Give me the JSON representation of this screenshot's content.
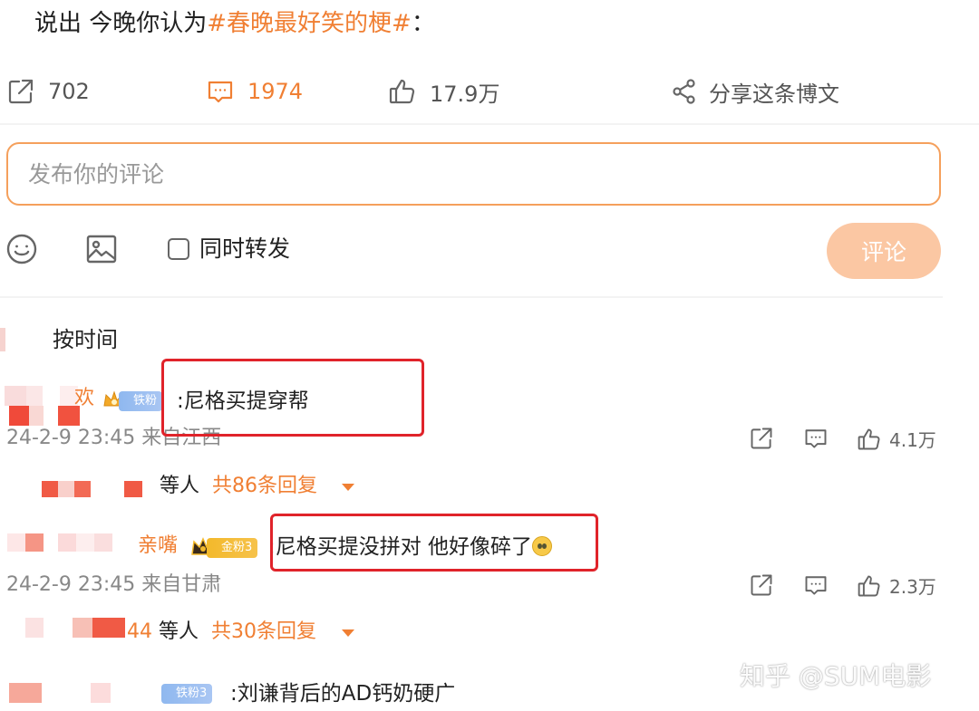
{
  "post": {
    "text_prefix": "说出 今晚你认为",
    "topic": "#春晚最好笑的梗#",
    "text_suffix": "："
  },
  "actions": {
    "repost_count": "702",
    "comment_count": "1974",
    "like_count": "17.9万",
    "share_label": "分享这条博文"
  },
  "composer": {
    "placeholder": "发布你的评论",
    "repost_label": "同时转发",
    "submit_label": "评论"
  },
  "sort": {
    "label": "按时间"
  },
  "comments": [
    {
      "username": "欢",
      "badge": "铁粉",
      "text": ":尼格买提穿帮",
      "meta": "24-2-9 23:45 来自江西",
      "likes": "4.1万",
      "reply_prefix": "等人",
      "reply_count": "共86条回复"
    },
    {
      "username": "亲嘴",
      "badge": "金粉3",
      "text": ":尼格买提没拼对 他好像碎了",
      "meta": "24-2-9 23:45 来自甘肃",
      "likes": "2.3万",
      "reply_prefix_num": "44",
      "reply_prefix": "等人",
      "reply_count": "共30条回复"
    },
    {
      "badge": "铁粉3",
      "text": ":刘谦背后的AD钙奶硬广"
    }
  ],
  "watermark": "知乎 @SUM电影",
  "colors": {
    "accent": "#f07f33",
    "highlight": "#e0232a",
    "submit_disabled": "#fbc7a3"
  }
}
